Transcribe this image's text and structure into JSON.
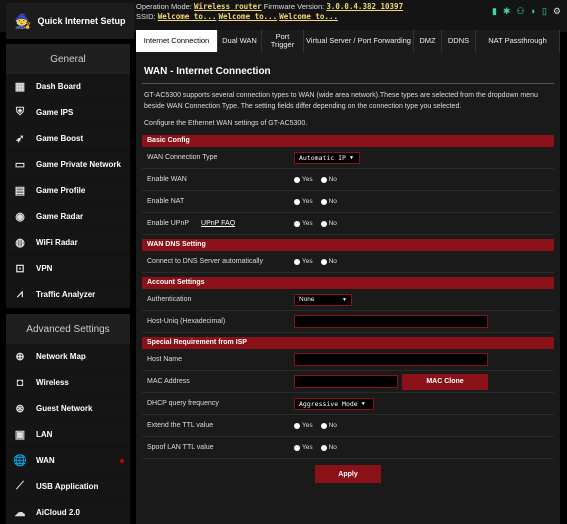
{
  "qis_label": "Quick Internet Setup",
  "operation_mode_label": "Operation Mode:",
  "operation_mode_value": "Wireless router",
  "firmware_label": "Firmware Version:",
  "firmware_value": "3.0.0.4.382_10397",
  "ssid_label": "SSID:",
  "ssid_values": [
    "Welcome to...",
    "Welcome to...",
    "Welcome to..."
  ],
  "tabs": [
    "Internet Connection",
    "Dual WAN",
    "Port Trigger",
    "Virtual Server / Port Forwarding",
    "DMZ",
    "DDNS",
    "NAT Passthrough"
  ],
  "sidebar": {
    "general_heading": "General",
    "general_items": [
      "Dash Board",
      "Game IPS",
      "Game Boost",
      "Game Private Network",
      "Game Profile",
      "Game Radar",
      "WiFi Radar",
      "VPN",
      "Traffic Analyzer"
    ],
    "advanced_heading": "Advanced Settings",
    "advanced_items": [
      "Network Map",
      "Wireless",
      "Guest Network",
      "LAN",
      "WAN",
      "USB Application",
      "AiCloud 2.0"
    ]
  },
  "page": {
    "title": "WAN - Internet Connection",
    "description": "GT-AC5300 supports several connection types to WAN (wide area network).These types are selected from the dropdown menu beside WAN Connection Type. The setting fields differ depending on the connection type you selected.",
    "configure_text": "Configure the Ethernet WAN settings of GT-AC5300."
  },
  "basic_config": {
    "heading": "Basic Config",
    "wan_type_label": "WAN Connection Type",
    "wan_type_value": "Automatic IP",
    "enable_wan_label": "Enable WAN",
    "enable_nat_label": "Enable NAT",
    "enable_upnp_label": "Enable UPnP",
    "upnp_faq_link": "UPnP  FAQ"
  },
  "radio": {
    "yes": "Yes",
    "no": "No"
  },
  "wan_dns": {
    "heading": "WAN DNS Setting",
    "connect_dns_label": "Connect to DNS Server automatically"
  },
  "account": {
    "heading": "Account Settings",
    "auth_label": "Authentication",
    "auth_value": "None",
    "host_uniq_label": "Host-Uniq (Hexadecimal)"
  },
  "isp": {
    "heading": "Special Requirement from ISP",
    "host_name_label": "Host Name",
    "mac_label": "MAC Address",
    "mac_clone_button": "MAC Clone",
    "dhcp_freq_label": "DHCP query frequency",
    "dhcp_freq_value": "Aggressive Mode",
    "ttl_label": "Extend the TTL value",
    "spoof_ttl_label": "Spoof LAN TTL value"
  },
  "apply_button": "Apply",
  "colors": {
    "accent": "#8a1118",
    "background": "#000000",
    "panel": "#1a1a1a"
  }
}
